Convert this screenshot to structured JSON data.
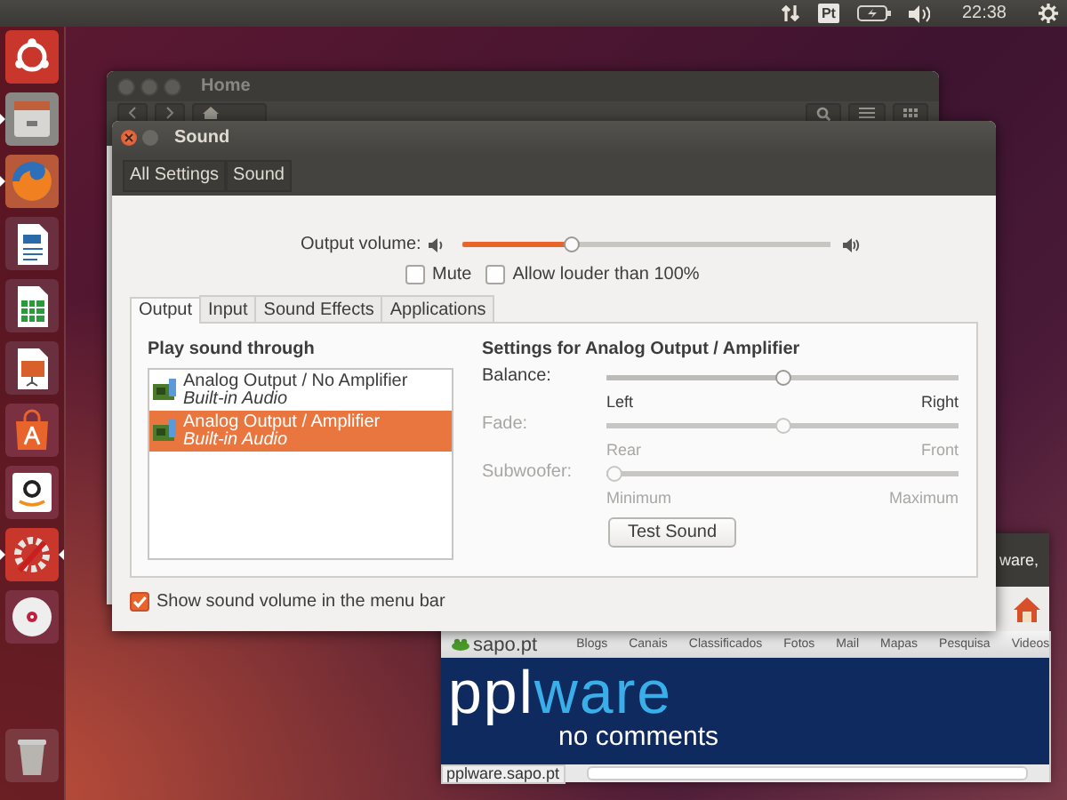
{
  "top_panel": {
    "keyboard_layout": "Pt",
    "clock": "22:38"
  },
  "launcher": {
    "items": [
      {
        "kind": "dash",
        "running": false,
        "focused": false
      },
      {
        "kind": "files",
        "running": true,
        "focused": false
      },
      {
        "kind": "firefox",
        "running": true,
        "focused": false
      },
      {
        "kind": "writer",
        "running": false,
        "focused": false
      },
      {
        "kind": "calc",
        "running": false,
        "focused": false
      },
      {
        "kind": "impress",
        "running": false,
        "focused": false
      },
      {
        "kind": "software",
        "running": false,
        "focused": false
      },
      {
        "kind": "amazon",
        "running": false,
        "focused": false
      },
      {
        "kind": "settings",
        "running": true,
        "focused": true
      },
      {
        "kind": "disc",
        "running": false,
        "focused": false
      },
      {
        "kind": "trash",
        "running": false,
        "focused": false
      }
    ]
  },
  "home_window": {
    "title": "Home"
  },
  "sound_window": {
    "title": "Sound",
    "breadcrumbs": [
      "All Settings",
      "Sound"
    ],
    "output_volume": {
      "label": "Output volume:",
      "level": 0.29
    },
    "mute": {
      "label": "Mute",
      "checked": false
    },
    "allow_louder": {
      "label": "Allow louder than 100%",
      "checked": false
    },
    "tabs": [
      {
        "label": "Output",
        "selected": true
      },
      {
        "label": "Input",
        "selected": false
      },
      {
        "label": "Sound Effects",
        "selected": false
      },
      {
        "label": "Applications",
        "selected": false
      }
    ],
    "devices_heading": "Play sound through",
    "devices": [
      {
        "name": "Analog Output / No Amplifier",
        "description": "Built-in Audio",
        "selected": false
      },
      {
        "name": "Analog Output / Amplifier",
        "description": "Built-in Audio",
        "selected": true
      }
    ],
    "settings_heading": "Settings for Analog Output / Amplifier",
    "sliders": [
      {
        "label": "Balance:",
        "level": 0.5,
        "min_label": "Left",
        "max_label": "Right",
        "disabled": false
      },
      {
        "label": "Fade:",
        "level": 0.5,
        "min_label": "Rear",
        "max_label": "Front",
        "disabled": true
      },
      {
        "label": "Subwoofer:",
        "level": 0,
        "min_label": "Minimum",
        "max_label": "Maximum",
        "disabled": true
      }
    ],
    "test_button": "Test Sound",
    "show_in_menu_bar": {
      "label": "Show sound volume in the menu bar",
      "checked": true
    }
  },
  "browser_window": {
    "header_fragment": "ware,",
    "site": "sapo.pt",
    "nav": [
      "Blogs",
      "Canais",
      "Classificados",
      "Fotos",
      "Mail",
      "Mapas",
      "Pesquisa",
      "Videos"
    ],
    "logo_parts": [
      "ppl",
      "ware"
    ],
    "tagline": "no comments",
    "status_url": "pplware.sapo.pt"
  }
}
